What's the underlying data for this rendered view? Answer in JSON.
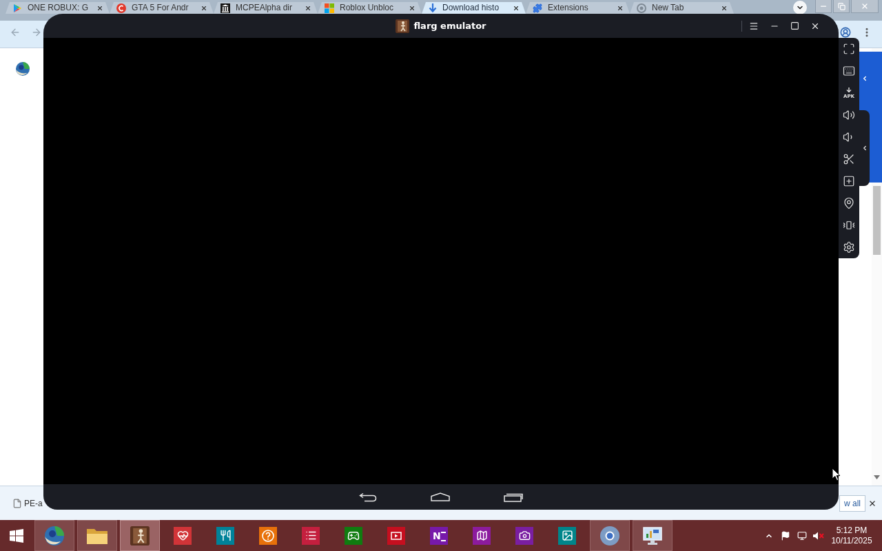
{
  "browser": {
    "tabs": [
      {
        "title": "ONE ROBUX: G",
        "selected": false
      },
      {
        "title": "GTA 5 For Andr",
        "selected": false
      },
      {
        "title": "MCPEAlpha dir",
        "selected": false
      },
      {
        "title": "Roblox Unbloc",
        "selected": false
      },
      {
        "title": "Download histo",
        "selected": true
      },
      {
        "title": "Extensions",
        "selected": false
      },
      {
        "title": "New Tab",
        "selected": false
      }
    ],
    "download_bar": {
      "file_name": "PE-a",
      "show_all_button": "w all"
    }
  },
  "emulator": {
    "title": "flarg emulator",
    "sidebar": {
      "apk_button": "APK"
    }
  },
  "taskbar": {
    "apps": [
      {
        "running": true,
        "active": false
      },
      {
        "running": true,
        "active": false
      },
      {
        "running": true,
        "active": true
      },
      {
        "running": false,
        "active": false
      },
      {
        "running": false,
        "active": false
      },
      {
        "running": false,
        "active": false
      },
      {
        "running": false,
        "active": false
      },
      {
        "running": false,
        "active": false
      },
      {
        "running": false,
        "active": false
      },
      {
        "label": "N",
        "running": false,
        "active": false
      },
      {
        "running": false,
        "active": false
      },
      {
        "running": false,
        "active": false
      },
      {
        "running": false,
        "active": false
      },
      {
        "running": true,
        "active": false
      },
      {
        "running": true,
        "active": false
      }
    ],
    "tray": {
      "volume_muted": true,
      "time": "5:12 PM",
      "date": "10/11/2025"
    }
  }
}
